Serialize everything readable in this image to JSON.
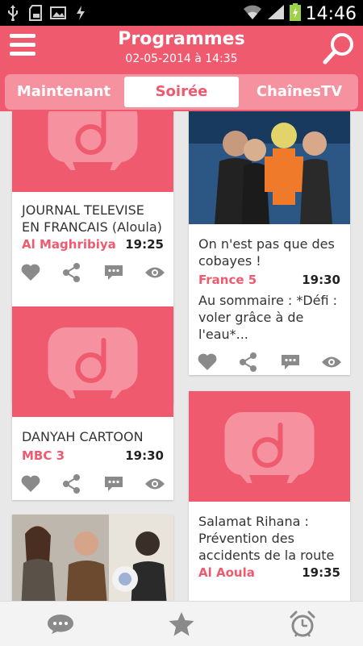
{
  "status_bar": {
    "time": "14:46",
    "icons": [
      "usb-icon",
      "sd-card-icon",
      "image-icon",
      "sync-icon",
      "wifi-icon",
      "signal-icon",
      "battery-charging-icon"
    ]
  },
  "app_bar": {
    "title": "Programmes",
    "subtitle": "02-05-2014 à 14:35",
    "menu_icon": "menu-icon",
    "search_icon": "search-icon"
  },
  "tabs": [
    {
      "label": "Maintenant",
      "active": false
    },
    {
      "label": "Soirée",
      "active": true
    },
    {
      "label": "ChaînesTV",
      "active": false
    }
  ],
  "programs": [
    {
      "title": "JOURNAL TELEVISE EN FRANCAIS (Aloula)",
      "channel": "Al Maghribiya",
      "time": "19:25",
      "image": "tv-logo-placeholder"
    },
    {
      "title": "On n'est pas que des cobayes !",
      "channel": "France 5",
      "time": "19:30",
      "summary": "Au sommaire : *Défi : voler grâce à de l'eau*...",
      "image": "photo"
    },
    {
      "title": "DANYAH CARTOON",
      "channel": "MBC 3",
      "time": "19:30",
      "image": "tv-logo-placeholder"
    },
    {
      "title": "Salamat Rihana : Prévention des accidents de la route",
      "channel": "Al Aoula",
      "time": "19:35",
      "image": "tv-logo-placeholder"
    },
    {
      "title": "",
      "channel": "",
      "time": "",
      "image": "photo"
    }
  ],
  "card_actions": [
    "heart-icon",
    "share-icon",
    "comment-icon",
    "eye-icon"
  ],
  "bottom_nav": [
    "chat-icon",
    "star-icon",
    "alarm-clock-icon"
  ],
  "colors": {
    "accent": "#ef5a6f",
    "tab_bg": "#f6919f",
    "background": "#e8e8e8"
  }
}
